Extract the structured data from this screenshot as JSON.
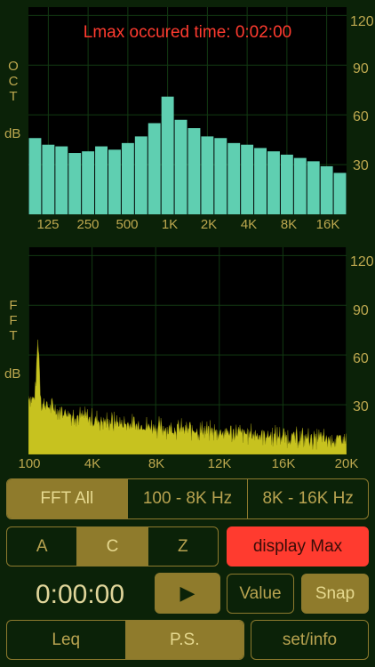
{
  "oct": {
    "side_label": [
      "O",
      "C",
      "T"
    ],
    "db_label": "dB",
    "lmax_text": "Lmax occured time: 0:02:00",
    "y_ticks": [
      "120",
      "90",
      "60",
      "30"
    ],
    "x_ticks": [
      "125",
      "250",
      "500",
      "1K",
      "2K",
      "4K",
      "8K",
      "16K"
    ],
    "bar_color": "#5fcfb1"
  },
  "fft": {
    "side_label": [
      "F",
      "F",
      "T"
    ],
    "db_label": "dB",
    "y_ticks": [
      "120",
      "90",
      "60",
      "30"
    ],
    "x_ticks": [
      "100",
      "4K",
      "8K",
      "12K",
      "16K",
      "20K"
    ],
    "trace_color": "#c7c21f"
  },
  "chart_data": [
    {
      "type": "bar",
      "title": "Lmax occured time: 0:02:00",
      "ylabel": "dB",
      "ylim": [
        0,
        125
      ],
      "xtick_labels": [
        "125",
        "250",
        "500",
        "1K",
        "2K",
        "4K",
        "8K",
        "16K"
      ],
      "values": [
        46,
        42,
        41,
        37,
        38,
        41,
        39,
        43,
        47,
        55,
        71,
        57,
        52,
        47,
        46,
        43,
        42,
        40,
        38,
        36,
        34,
        32,
        29,
        25
      ]
    },
    {
      "type": "area",
      "ylabel": "dB",
      "ylim": [
        0,
        125
      ],
      "xlim_hz": [
        100,
        20000
      ],
      "xtick_labels": [
        "100",
        "4K",
        "8K",
        "12K",
        "16K",
        "20K"
      ],
      "peak_db": 73,
      "peak_hz": 700
    }
  ],
  "controls": {
    "range_tabs": [
      "FFT All",
      "100 - 8K Hz",
      "8K - 16K Hz"
    ],
    "range_selected": 0,
    "weight_tabs": [
      "A",
      "C",
      "Z"
    ],
    "weight_selected": 1,
    "display_max": "display Max",
    "timer": "0:00:00",
    "play_symbol": "▶",
    "value": "Value",
    "snap": "Snap",
    "leq": "Leq",
    "ps": "P.S.",
    "set_info": "set/info"
  },
  "colors": {
    "background": "#0b2208",
    "accent": "#8f7b2c",
    "display_max": "#ff3b2f"
  }
}
